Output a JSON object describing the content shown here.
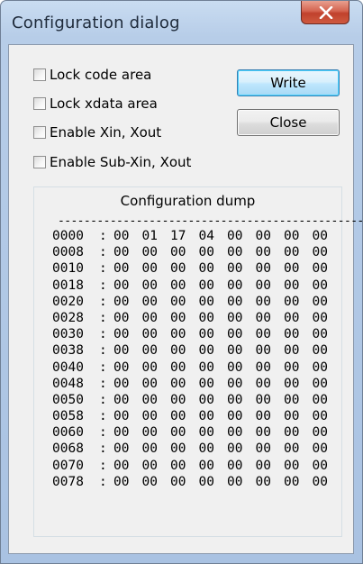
{
  "window": {
    "title": "Configuration dialog",
    "close_icon": "close-x-icon"
  },
  "options": [
    {
      "label": "Lock code area",
      "checked": false
    },
    {
      "label": "Lock xdata area",
      "checked": false
    },
    {
      "label": "Enable Xin, Xout",
      "checked": false
    },
    {
      "label": "Enable Sub-Xin, Xout",
      "checked": false
    }
  ],
  "buttons": {
    "write": "Write",
    "close": "Close"
  },
  "dump": {
    "title": "Configuration dump",
    "rule": "------------------------------------------------",
    "rows": [
      {
        "addr": "0000",
        "sep": ":",
        "bytes": [
          "00",
          "01",
          "17",
          "04",
          "00",
          "00",
          "00",
          "00"
        ]
      },
      {
        "addr": "0008",
        "sep": ":",
        "bytes": [
          "00",
          "00",
          "00",
          "00",
          "00",
          "00",
          "00",
          "00"
        ]
      },
      {
        "addr": "0010",
        "sep": ":",
        "bytes": [
          "00",
          "00",
          "00",
          "00",
          "00",
          "00",
          "00",
          "00"
        ]
      },
      {
        "addr": "0018",
        "sep": ":",
        "bytes": [
          "00",
          "00",
          "00",
          "00",
          "00",
          "00",
          "00",
          "00"
        ]
      },
      {
        "addr": "0020",
        "sep": ":",
        "bytes": [
          "00",
          "00",
          "00",
          "00",
          "00",
          "00",
          "00",
          "00"
        ]
      },
      {
        "addr": "0028",
        "sep": ":",
        "bytes": [
          "00",
          "00",
          "00",
          "00",
          "00",
          "00",
          "00",
          "00"
        ]
      },
      {
        "addr": "0030",
        "sep": ":",
        "bytes": [
          "00",
          "00",
          "00",
          "00",
          "00",
          "00",
          "00",
          "00"
        ]
      },
      {
        "addr": "0038",
        "sep": ":",
        "bytes": [
          "00",
          "00",
          "00",
          "00",
          "00",
          "00",
          "00",
          "00"
        ]
      },
      {
        "addr": "0040",
        "sep": ":",
        "bytes": [
          "00",
          "00",
          "00",
          "00",
          "00",
          "00",
          "00",
          "00"
        ]
      },
      {
        "addr": "0048",
        "sep": ":",
        "bytes": [
          "00",
          "00",
          "00",
          "00",
          "00",
          "00",
          "00",
          "00"
        ]
      },
      {
        "addr": "0050",
        "sep": ":",
        "bytes": [
          "00",
          "00",
          "00",
          "00",
          "00",
          "00",
          "00",
          "00"
        ]
      },
      {
        "addr": "0058",
        "sep": ":",
        "bytes": [
          "00",
          "00",
          "00",
          "00",
          "00",
          "00",
          "00",
          "00"
        ]
      },
      {
        "addr": "0060",
        "sep": ":",
        "bytes": [
          "00",
          "00",
          "00",
          "00",
          "00",
          "00",
          "00",
          "00"
        ]
      },
      {
        "addr": "0068",
        "sep": ":",
        "bytes": [
          "00",
          "00",
          "00",
          "00",
          "00",
          "00",
          "00",
          "00"
        ]
      },
      {
        "addr": "0070",
        "sep": ":",
        "bytes": [
          "00",
          "00",
          "00",
          "00",
          "00",
          "00",
          "00",
          "00"
        ]
      },
      {
        "addr": "0078",
        "sep": ":",
        "bytes": [
          "00",
          "00",
          "00",
          "00",
          "00",
          "00",
          "00",
          "00"
        ]
      }
    ]
  }
}
